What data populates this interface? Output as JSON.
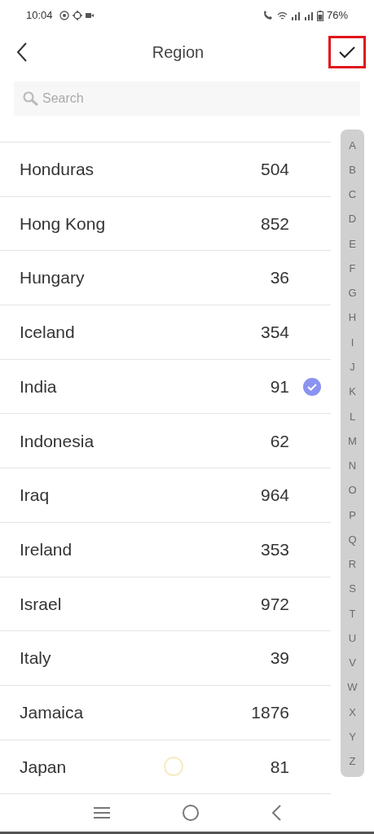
{
  "status_bar": {
    "time": "10:04",
    "battery": "76%"
  },
  "header": {
    "title": "Region",
    "confirm_highlighted": true
  },
  "search": {
    "placeholder": "Search"
  },
  "regions": [
    {
      "name": "Honduras",
      "code": "504",
      "selected": false
    },
    {
      "name": "Hong Kong",
      "code": "852",
      "selected": false
    },
    {
      "name": "Hungary",
      "code": "36",
      "selected": false
    },
    {
      "name": "Iceland",
      "code": "354",
      "selected": false
    },
    {
      "name": "India",
      "code": "91",
      "selected": true
    },
    {
      "name": "Indonesia",
      "code": "62",
      "selected": false
    },
    {
      "name": "Iraq",
      "code": "964",
      "selected": false
    },
    {
      "name": "Ireland",
      "code": "353",
      "selected": false
    },
    {
      "name": "Israel",
      "code": "972",
      "selected": false
    },
    {
      "name": "Italy",
      "code": "39",
      "selected": false
    },
    {
      "name": "Jamaica",
      "code": "1876",
      "selected": false
    },
    {
      "name": "Japan",
      "code": "81",
      "selected": false
    }
  ],
  "index_letters": [
    "A",
    "B",
    "C",
    "D",
    "E",
    "F",
    "G",
    "H",
    "I",
    "J",
    "K",
    "L",
    "M",
    "N",
    "O",
    "P",
    "Q",
    "R",
    "S",
    "T",
    "U",
    "V",
    "W",
    "X",
    "Y",
    "Z"
  ]
}
